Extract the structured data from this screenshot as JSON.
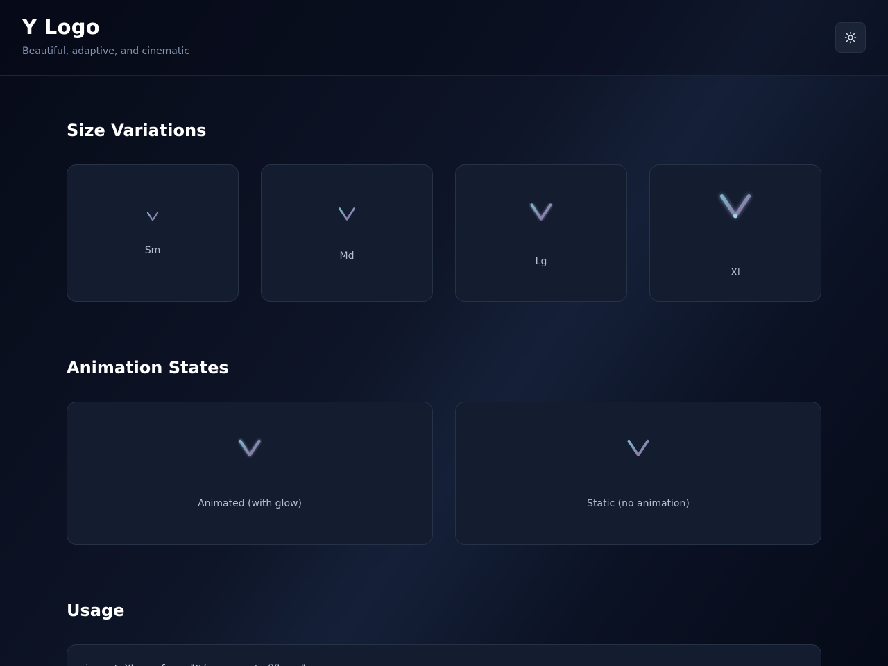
{
  "header": {
    "title": "Y Logo",
    "subtitle": "Beautiful, adaptive, and cinematic",
    "theme_toggle_icon": "sun-icon"
  },
  "sections": {
    "sizes": {
      "title": "Size Variations",
      "cards": [
        {
          "label": "Sm"
        },
        {
          "label": "Md"
        },
        {
          "label": "Lg"
        },
        {
          "label": "Xl"
        }
      ]
    },
    "animation": {
      "title": "Animation States",
      "cards": [
        {
          "label": "Animated (with glow)"
        },
        {
          "label": "Static (no animation)"
        }
      ]
    },
    "usage": {
      "title": "Usage",
      "code": "import YLogo from \"@/components/YLogo\";"
    }
  },
  "colors": {
    "logo_start": "#7fb3c9",
    "logo_end": "#8a6a9c",
    "accent_dot": "#9fd6e6"
  }
}
